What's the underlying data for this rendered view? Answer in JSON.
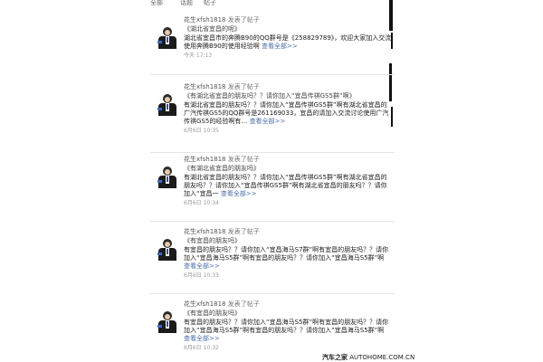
{
  "tabs": [
    "全部",
    "话题",
    "帖子"
  ],
  "posts": [
    {
      "user": "花生xfsh1818",
      "action": "发表了帖子",
      "title": "《湖北省宜昌的呢》",
      "content": "湖北省宜昌市的奔腾B90的QQ群号是《258829789》，欢迎大家加入交流使用奔腾B90的使用经验啊",
      "more": "查看全部>>",
      "time": "今天 17:13"
    },
    {
      "user": "花生xfsh1818",
      "action": "发表了帖子",
      "title": "《有湖北省宜昌的朋友吗？？请你加入“宜昌传祺GS5群”啊》",
      "content": "有湖北省宜昌的朋友吗？？请你加入“宜昌传祺GS5群”啊有湖北省宜昌的广汽传祺GS5的QQ群号是261169033，宜昌的请加入交流讨论使用广汽传祺GS5的经验啊有…",
      "more": "查看全部>>",
      "time": "6月6日 10:35"
    },
    {
      "user": "花生xfsh1818",
      "action": "发表了帖子",
      "title": "《有湖北省宜昌的朋友吗》",
      "content": "有湖北省宜昌的朋友吗？？请你加入“宜昌传祺GS5群”啊有湖北省宜昌的朋友吗？？请你加入“宜昌传祺GS5群”啊有湖北省宜昌的朋友吗？？请你加入“宜昌一",
      "more": "查看全部>>",
      "time": "6月6日 10:34"
    },
    {
      "user": "花生xfsh1818",
      "action": "发表了帖子",
      "title": "《有宜昌的朋友吗》",
      "content": "有宜昌的朋友吗？？请你加入“宜昌海马S7群”啊有宜昌的朋友吗？？请你加入“宜昌海马S5群”啊有宜昌的朋友吗？？请你加入“宜昌海马S5群”啊",
      "more": "查看全部>>",
      "time": "6月6日 10:33"
    },
    {
      "user": "花生xfsh1818",
      "action": "发表了帖子",
      "title": "《有宜昌的朋友吗》",
      "content": "有宜昌的朋友吗？？请你加入“宜昌海马S5群”啊有宜昌的朋友吗？？请你加入“宜昌海马S5群”啊有宜昌的朋友吗？？请你加入“宜昌海马S5群”啊",
      "more": "查看全部>>",
      "time": "6月6日 10:32"
    }
  ],
  "footer": {
    "brand": "汽车之家",
    "domain": "AUTOHOME.COM.CN"
  }
}
